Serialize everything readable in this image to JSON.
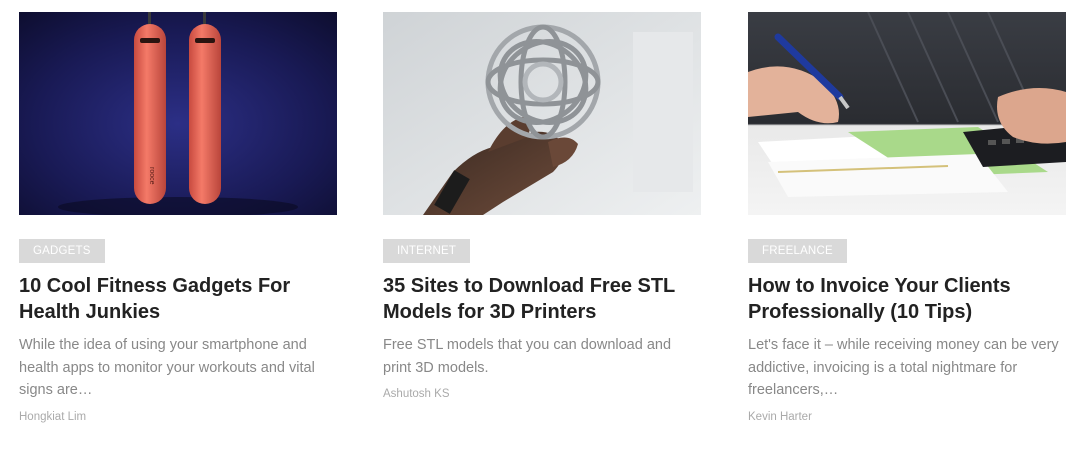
{
  "articles": [
    {
      "category": "GADGETS",
      "title": "10 Cool Fitness Gadgets For Health Junkies",
      "excerpt": "While the idea of using your smartphone and health apps to monitor your workouts and vital signs are…",
      "author": "Hongkiat Lim",
      "image_icon": "jump-rope-image"
    },
    {
      "category": "INTERNET",
      "title": "35 Sites to Download Free STL Models for 3D Printers",
      "excerpt": "Free STL models that you can download and print 3D models.",
      "author": "Ashutosh KS",
      "image_icon": "3d-printed-sphere-image"
    },
    {
      "category": "FREELANCE",
      "title": "How to Invoice Your Clients Professionally (10 Tips)",
      "excerpt": "Let's face it – while receiving money can be very addictive, invoicing is a total nightmare for freelancers,…",
      "author": "Kevin Harter",
      "image_icon": "invoice-calculator-image"
    }
  ],
  "colors": {
    "category_bg": "#d9d9d9",
    "title": "#222222",
    "excerpt": "#888888",
    "author": "#aaaaaa"
  }
}
